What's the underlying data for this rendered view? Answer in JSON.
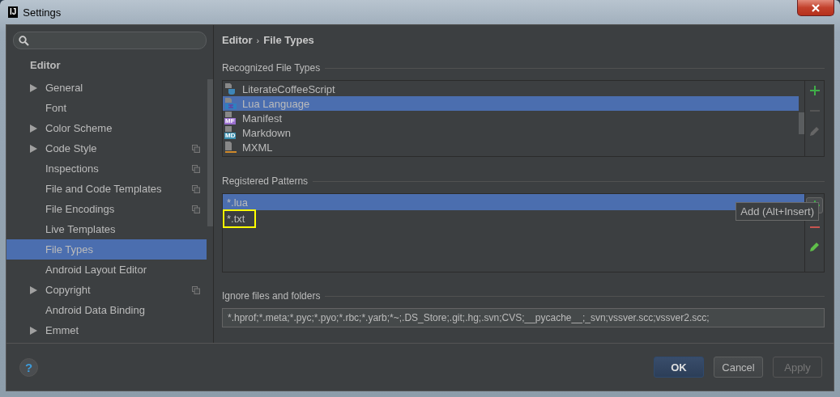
{
  "window": {
    "title": "Settings",
    "logo": "IJ"
  },
  "sidebar": {
    "section": "Editor",
    "items": [
      {
        "label": "General",
        "expandable": true,
        "project_level": false,
        "selected": false
      },
      {
        "label": "Font",
        "expandable": false,
        "project_level": false,
        "selected": false
      },
      {
        "label": "Color Scheme",
        "expandable": true,
        "project_level": false,
        "selected": false
      },
      {
        "label": "Code Style",
        "expandable": true,
        "project_level": true,
        "selected": false
      },
      {
        "label": "Inspections",
        "expandable": false,
        "project_level": true,
        "selected": false
      },
      {
        "label": "File and Code Templates",
        "expandable": false,
        "project_level": true,
        "selected": false
      },
      {
        "label": "File Encodings",
        "expandable": false,
        "project_level": true,
        "selected": false
      },
      {
        "label": "Live Templates",
        "expandable": false,
        "project_level": false,
        "selected": false
      },
      {
        "label": "File Types",
        "expandable": false,
        "project_level": false,
        "selected": true
      },
      {
        "label": "Android Layout Editor",
        "expandable": false,
        "project_level": false,
        "selected": false
      },
      {
        "label": "Copyright",
        "expandable": true,
        "project_level": true,
        "selected": false
      },
      {
        "label": "Android Data Binding",
        "expandable": false,
        "project_level": false,
        "selected": false
      },
      {
        "label": "Emmet",
        "expandable": true,
        "project_level": false,
        "selected": false
      }
    ]
  },
  "breadcrumb": [
    {
      "label": "Editor"
    },
    {
      "label": "File Types"
    }
  ],
  "breadcrumb_separator": "›",
  "recognized": {
    "title": "Recognized File Types",
    "items": [
      {
        "label": "LiterateCoffeeScript",
        "kind": "coffee",
        "selected": false
      },
      {
        "label": "Lua Language",
        "kind": "lua",
        "selected": true
      },
      {
        "label": "Manifest",
        "kind": "badge",
        "badge": "MF",
        "color": "#9a6fd0",
        "selected": false
      },
      {
        "label": "Markdown",
        "kind": "badge",
        "badge": "MD",
        "color": "#3a8fb0",
        "selected": false
      },
      {
        "label": "MXML",
        "kind": "xml",
        "selected": false
      }
    ]
  },
  "patterns": {
    "title": "Registered Patterns",
    "items": [
      {
        "label": "*.lua",
        "selected": true,
        "highlighted": false
      },
      {
        "label": "*.txt",
        "selected": false,
        "highlighted": true
      }
    ],
    "tooltip": "Add (Alt+Insert)"
  },
  "ignore": {
    "title": "Ignore files and folders",
    "value": "*.hprof;*.meta;*.pyc;*.pyo;*.rbc;*.yarb;*~;.DS_Store;.git;.hg;.svn;CVS;__pycache__;_svn;vssver.scc;vssver2.scc;"
  },
  "buttons": [
    {
      "label": "OK",
      "kind": "default",
      "disabled": false
    },
    {
      "label": "Cancel",
      "kind": "normal",
      "disabled": false
    },
    {
      "label": "Apply",
      "kind": "normal",
      "disabled": true
    }
  ],
  "help": "?"
}
